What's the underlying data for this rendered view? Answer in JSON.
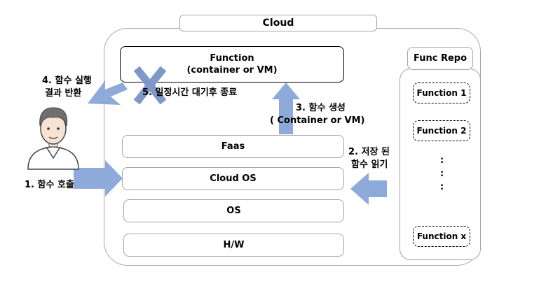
{
  "cloud": {
    "title": "Cloud"
  },
  "function_box": {
    "line1": "Function",
    "line2": "(container or VM)"
  },
  "func_repo": {
    "title": "Func Repo",
    "items": [
      "Function 1",
      "Function 2",
      "Function x"
    ],
    "ellipsis": [
      ":",
      ":",
      ":"
    ]
  },
  "stack": [
    "Faas",
    "Cloud OS",
    "OS",
    "H/W"
  ],
  "steps": {
    "step1": "1. 함수 호출",
    "step2_line1": "2. 저장 된",
    "step2_line2": "함수 읽기",
    "step3_line1": "3. 함수 생성",
    "step3_line2": "( Container or VM)",
    "step4_line1": "4. 함수 실행",
    "step4_line2": "결과 반환",
    "step5": "5. 일정시간 대기후 종료"
  },
  "colors": {
    "arrow": "#8eaadb",
    "border": "#a6a6a6",
    "cross": "#7f98c8"
  }
}
